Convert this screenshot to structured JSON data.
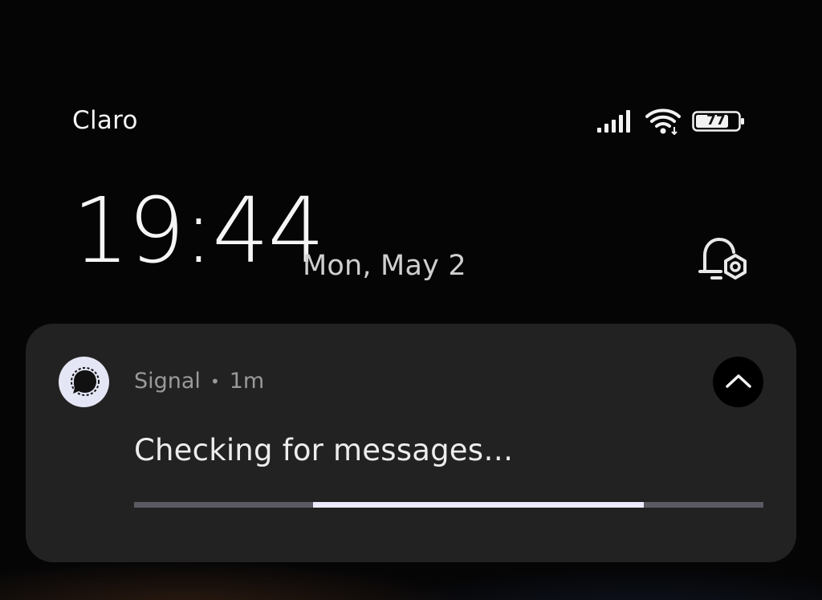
{
  "status_bar": {
    "carrier": "Claro",
    "battery_level": "77",
    "icons": [
      "signal-icon",
      "wifi-icon",
      "battery-icon"
    ]
  },
  "lockscreen": {
    "time": "19:44",
    "date": "Mon, May 2",
    "notification_settings_icon": "bell-settings-icon"
  },
  "notification": {
    "app_name": "Signal",
    "separator": "•",
    "age": "1m",
    "title": "Checking for messages…",
    "app_icon": "signal-bubble-icon",
    "collapse_icon": "chevron-up-icon",
    "progress": {
      "type": "indeterminate",
      "highlight_start_fraction": 0.285,
      "highlight_end_fraction": 0.81
    }
  },
  "colors": {
    "background": "#050506",
    "card": "#222222",
    "progress_highlight": "#ecebff",
    "progress_track": "#5a5a62",
    "signal_icon_bg": "#e5e6f5"
  }
}
